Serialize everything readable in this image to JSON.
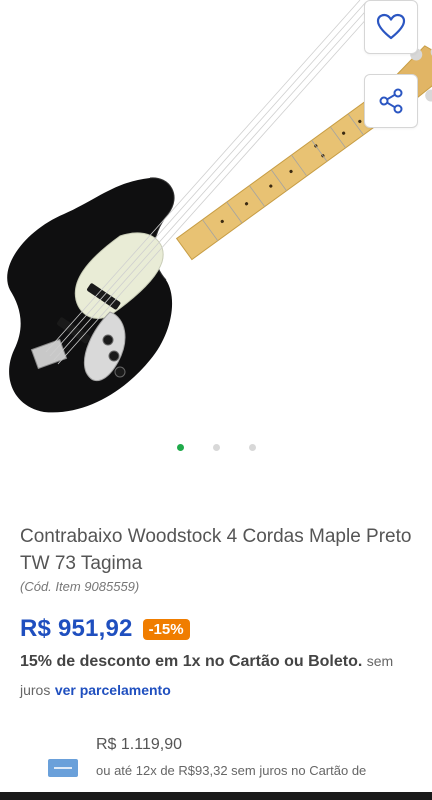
{
  "product": {
    "title": "Contrabaixo Woodstock 4 Cordas Maple Preto TW 73 Tagima",
    "code": "(Cód. Item 9085559)",
    "price": "R$ 951,92",
    "discount_badge": "-15%",
    "discount_text": "15% de desconto em 1x no Cartão ou Boleto.",
    "no_interest": "sem juros",
    "installments_link": "ver parcelamento",
    "full_price": "R$ 1.119,90",
    "installment_text": "ou até 12x de R$93,32 sem juros no Cartão de"
  },
  "gallery": {
    "image_name": "black-jazz-bass-guitar",
    "slide_count": 3,
    "active_slide": 0
  },
  "actions": {
    "favorite_icon": "heart-icon",
    "share_icon": "share-icon"
  },
  "colors": {
    "accent_blue": "#1f4fbf",
    "discount_orange": "#f07d00",
    "active_dot_green": "#1faa4a",
    "card_blue": "#6aa0da"
  }
}
